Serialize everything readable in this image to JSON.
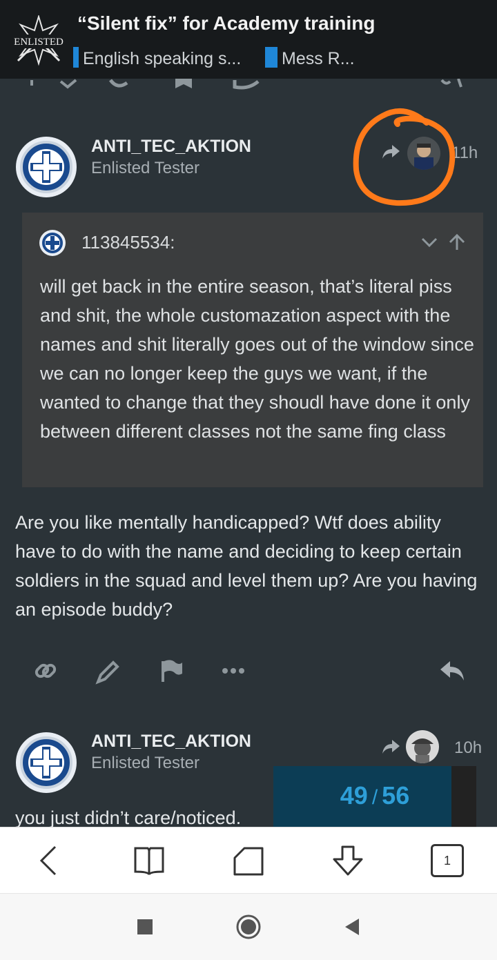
{
  "header": {
    "logo_text": "ENLISTED",
    "title": "“Silent fix” for Academy training",
    "categories": [
      {
        "label": "English speaking s...",
        "color": "#1f87d8"
      },
      {
        "label": "Mess R...",
        "color": "#1f87d8"
      }
    ]
  },
  "posts": [
    {
      "username": "ANTI_TEC_AKTION",
      "user_title": "Enlisted Tester",
      "time": "11h",
      "quote": {
        "username": "113845534:",
        "text": "will get back in the entire season, that’s literal piss and shit, the whole customazation aspect with the names and shit literally goes out of the window since we can no longer keep the guys we want, if the wanted to change that they shoudl have done it only between different classes not the same fing class"
      },
      "body": "Are you like mentally handicapped? Wtf does ability have to do with the name and deciding to keep certain soldiers in the squad and level them up? Are you having an episode buddy?"
    },
    {
      "username": "ANTI_TEC_AKTION",
      "user_title": "Enlisted Tester",
      "time": "10h",
      "body_partial": "you just didn’t care/noticed."
    }
  ],
  "progress": {
    "current": "49",
    "separator": "/",
    "total": "56"
  },
  "browser": {
    "tab_count": "1"
  },
  "colors": {
    "background": "#2b3338",
    "accent": "#2e9fd8",
    "annotation": "#ff7a1a"
  }
}
